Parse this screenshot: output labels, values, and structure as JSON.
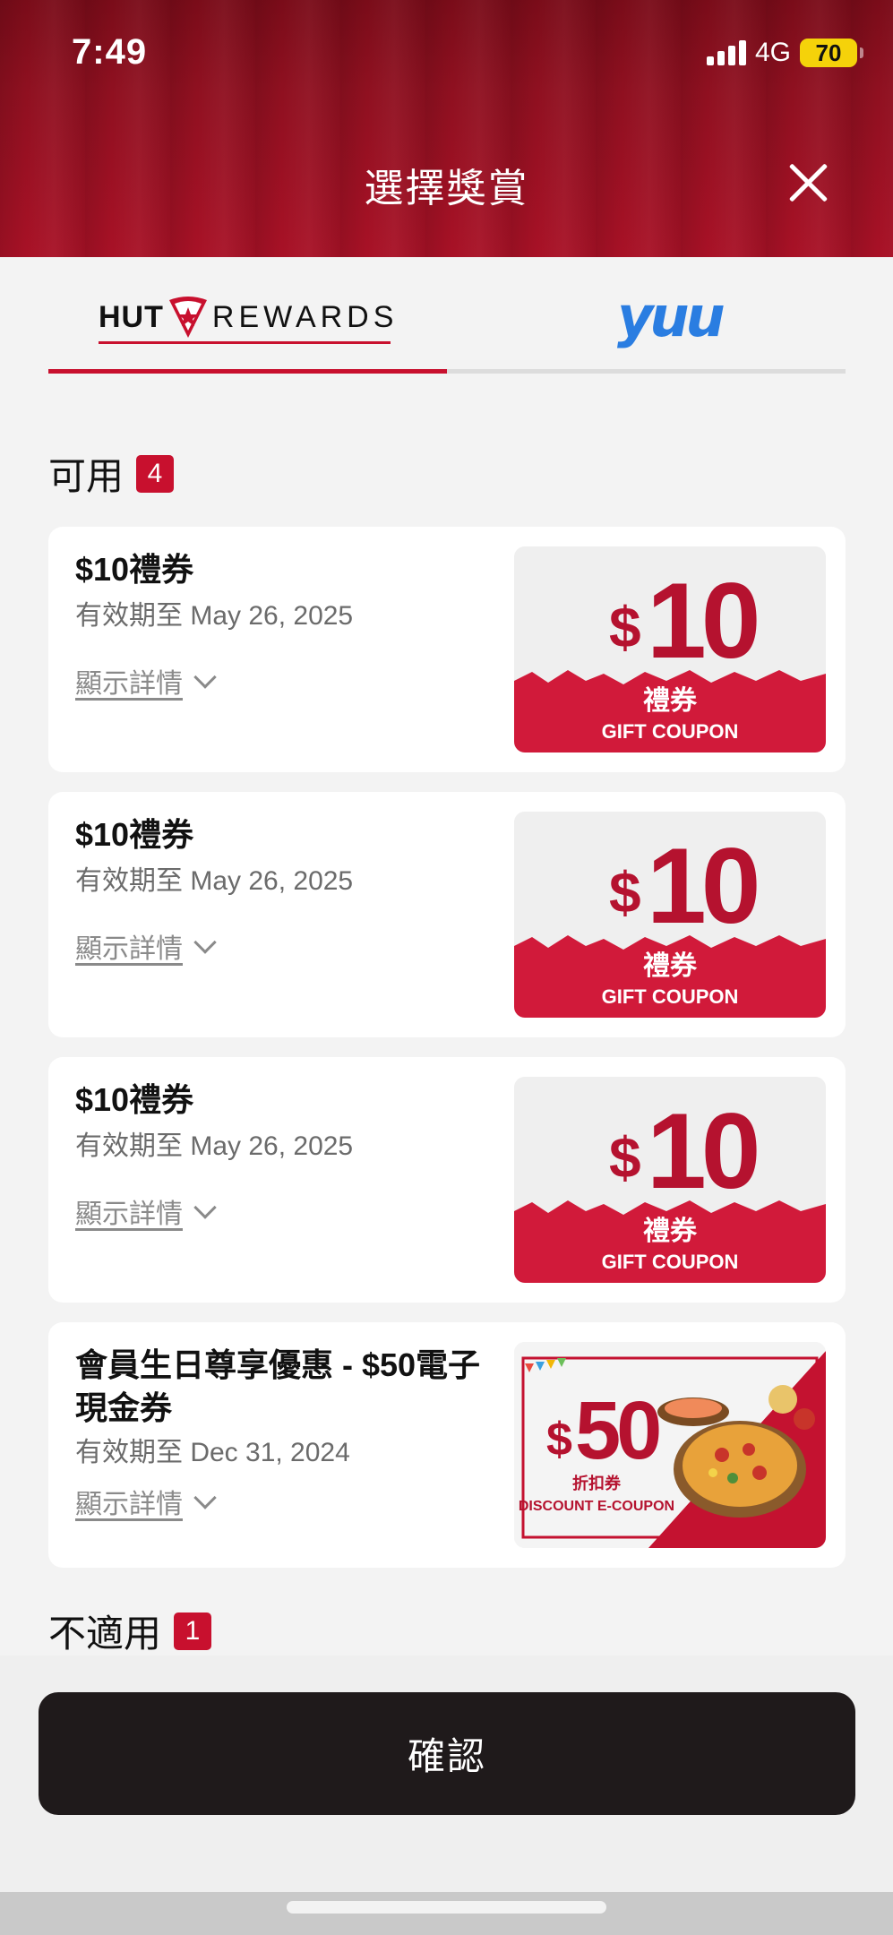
{
  "status": {
    "time": "7:49",
    "network": "4G",
    "battery": "70"
  },
  "header": {
    "title": "選擇獎賞"
  },
  "tabs": [
    {
      "brand_left": "HUT",
      "brand_right": "REWARDS"
    },
    {
      "label": "yuu"
    }
  ],
  "available": {
    "label": "可用",
    "count": "4",
    "items": [
      {
        "title": "$10禮券",
        "expiry": "有效期至 May 26, 2025",
        "detail": "顯示詳情"
      },
      {
        "title": "$10禮券",
        "expiry": "有效期至 May 26, 2025",
        "detail": "顯示詳情"
      },
      {
        "title": "$10禮券",
        "expiry": "有效期至 May 26, 2025",
        "detail": "顯示詳情"
      },
      {
        "title": "會員生日尊享優惠 - $50電子現金券",
        "expiry": "有效期至 Dec 31, 2024",
        "detail": "顯示詳情"
      }
    ]
  },
  "coupon10": {
    "dollar": "$",
    "amount": "10",
    "zh": "禮券",
    "en": "GIFT COUPON"
  },
  "coupon50": {
    "dollar": "$",
    "amount": "50",
    "zh": "折扣券",
    "en": "DISCOUNT E-COUPON"
  },
  "unavailable": {
    "label": "不適用",
    "count": "1"
  },
  "confirm": {
    "label": "確認"
  },
  "colors": {
    "brand_red": "#c8102e",
    "header_red": "#8f1020",
    "button_dark": "#1f1a1b",
    "yuu_blue": "#2a7de1"
  }
}
